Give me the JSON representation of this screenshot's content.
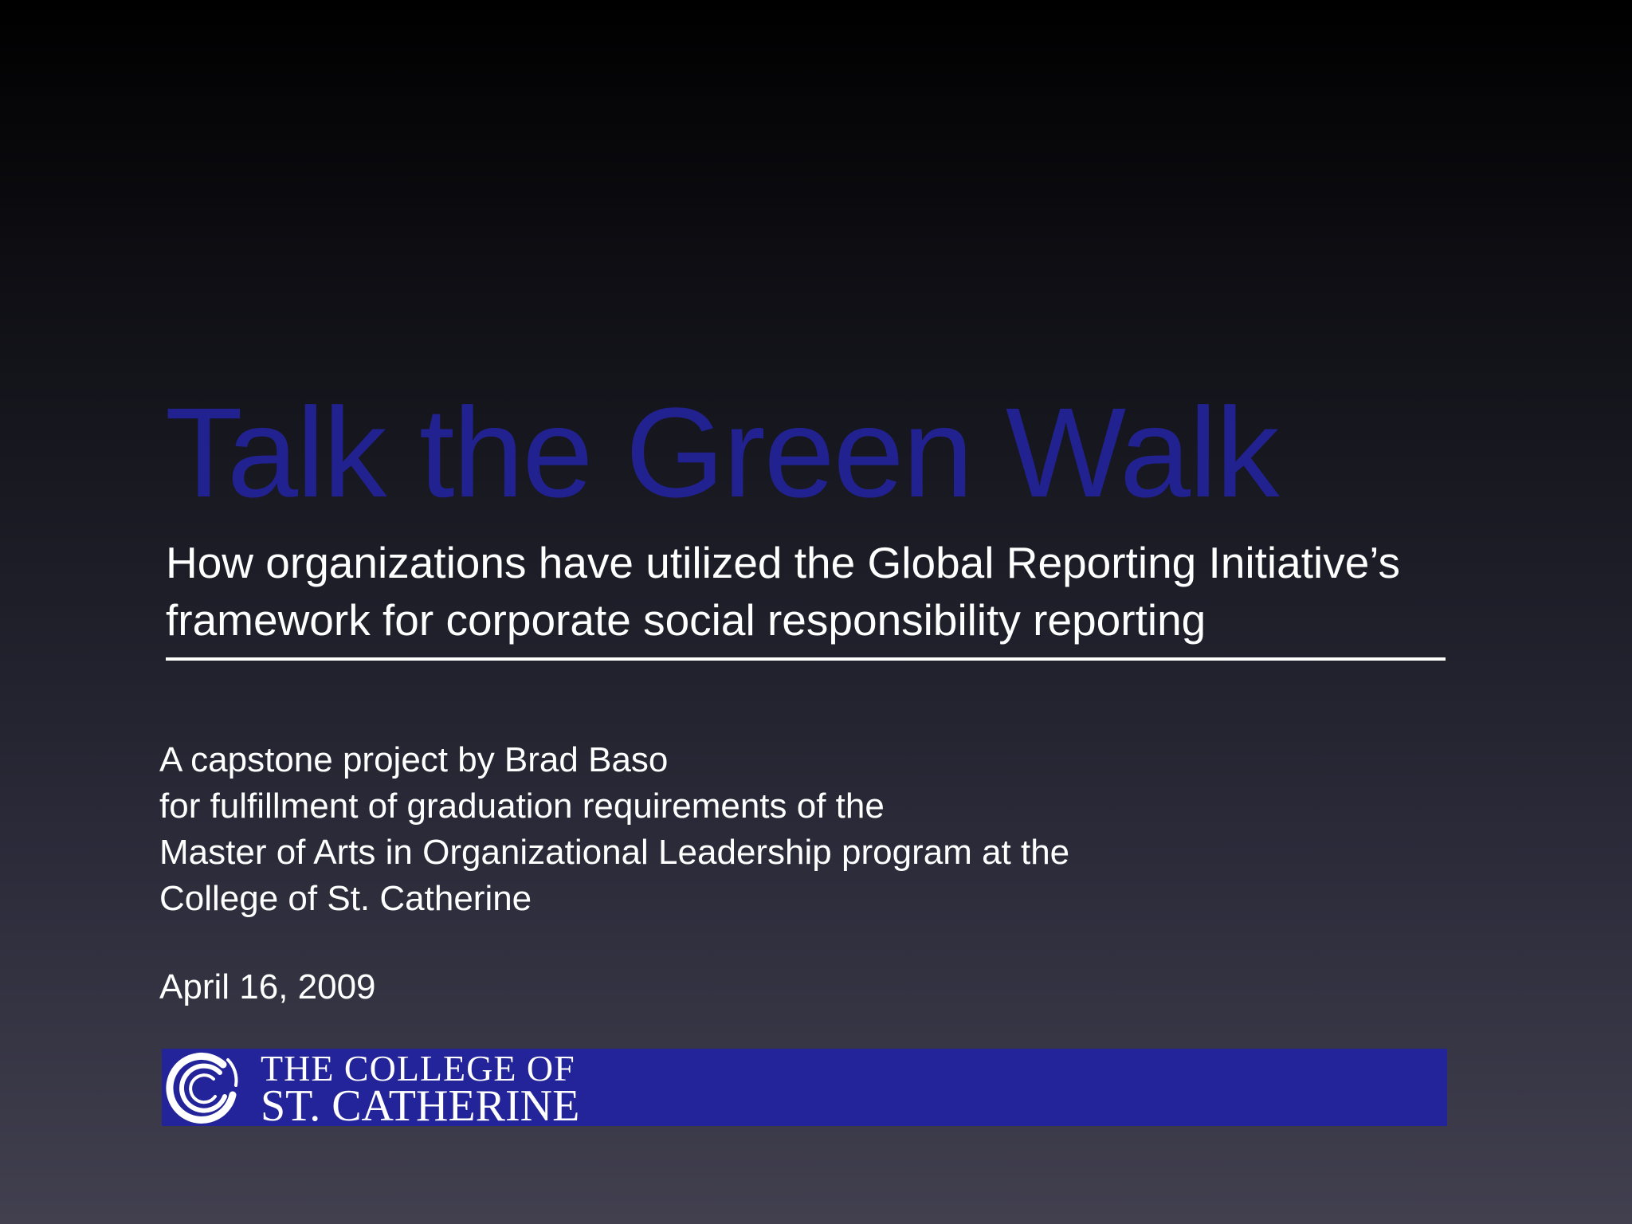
{
  "slide": {
    "title": "Talk the Green Walk",
    "subtitle_lines": [
      "How organizations have utilized the Global Reporting Initiative’s",
      "framework for corporate social responsibility reporting"
    ],
    "byline_lines": [
      "A capstone project by Brad Baso",
      "for fulfillment of graduation requirements of the",
      "Master of Arts in Organizational Leadership program at the",
      "College of St. Catherine"
    ],
    "date": "April 16, 2009"
  },
  "logo": {
    "line1": "THE COLLEGE OF",
    "line2": "ST. CATHERINE",
    "icon": "swirl-circle-icon"
  },
  "colors": {
    "title": "#21228f",
    "banner": "#24249a",
    "text": "#ffffff"
  }
}
